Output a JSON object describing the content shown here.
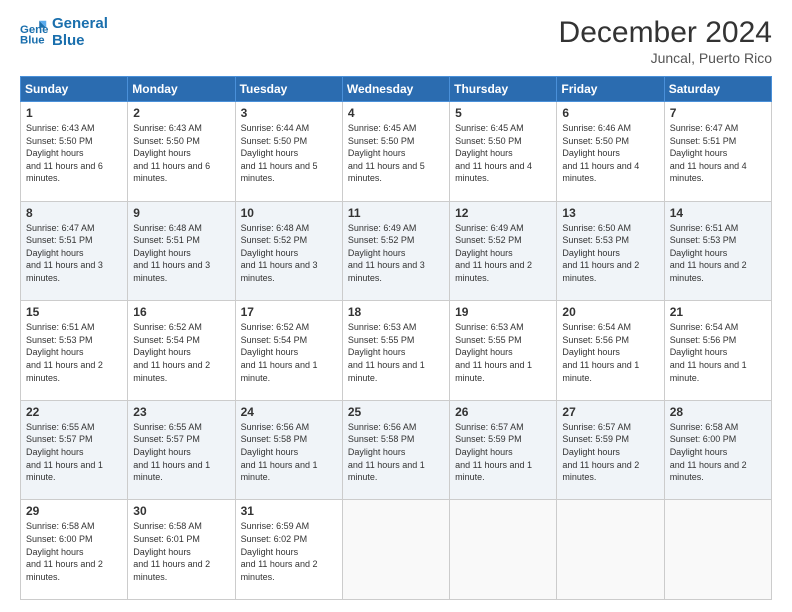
{
  "logo": {
    "line1": "General",
    "line2": "Blue"
  },
  "title": "December 2024",
  "subtitle": "Juncal, Puerto Rico",
  "days_header": [
    "Sunday",
    "Monday",
    "Tuesday",
    "Wednesday",
    "Thursday",
    "Friday",
    "Saturday"
  ],
  "weeks": [
    [
      {
        "day": "1",
        "sunrise": "6:43 AM",
        "sunset": "5:50 PM",
        "daylight": "11 hours and 6 minutes."
      },
      {
        "day": "2",
        "sunrise": "6:43 AM",
        "sunset": "5:50 PM",
        "daylight": "11 hours and 6 minutes."
      },
      {
        "day": "3",
        "sunrise": "6:44 AM",
        "sunset": "5:50 PM",
        "daylight": "11 hours and 5 minutes."
      },
      {
        "day": "4",
        "sunrise": "6:45 AM",
        "sunset": "5:50 PM",
        "daylight": "11 hours and 5 minutes."
      },
      {
        "day": "5",
        "sunrise": "6:45 AM",
        "sunset": "5:50 PM",
        "daylight": "11 hours and 4 minutes."
      },
      {
        "day": "6",
        "sunrise": "6:46 AM",
        "sunset": "5:50 PM",
        "daylight": "11 hours and 4 minutes."
      },
      {
        "day": "7",
        "sunrise": "6:47 AM",
        "sunset": "5:51 PM",
        "daylight": "11 hours and 4 minutes."
      }
    ],
    [
      {
        "day": "8",
        "sunrise": "6:47 AM",
        "sunset": "5:51 PM",
        "daylight": "11 hours and 3 minutes."
      },
      {
        "day": "9",
        "sunrise": "6:48 AM",
        "sunset": "5:51 PM",
        "daylight": "11 hours and 3 minutes."
      },
      {
        "day": "10",
        "sunrise": "6:48 AM",
        "sunset": "5:52 PM",
        "daylight": "11 hours and 3 minutes."
      },
      {
        "day": "11",
        "sunrise": "6:49 AM",
        "sunset": "5:52 PM",
        "daylight": "11 hours and 3 minutes."
      },
      {
        "day": "12",
        "sunrise": "6:49 AM",
        "sunset": "5:52 PM",
        "daylight": "11 hours and 2 minutes."
      },
      {
        "day": "13",
        "sunrise": "6:50 AM",
        "sunset": "5:53 PM",
        "daylight": "11 hours and 2 minutes."
      },
      {
        "day": "14",
        "sunrise": "6:51 AM",
        "sunset": "5:53 PM",
        "daylight": "11 hours and 2 minutes."
      }
    ],
    [
      {
        "day": "15",
        "sunrise": "6:51 AM",
        "sunset": "5:53 PM",
        "daylight": "11 hours and 2 minutes."
      },
      {
        "day": "16",
        "sunrise": "6:52 AM",
        "sunset": "5:54 PM",
        "daylight": "11 hours and 2 minutes."
      },
      {
        "day": "17",
        "sunrise": "6:52 AM",
        "sunset": "5:54 PM",
        "daylight": "11 hours and 1 minute."
      },
      {
        "day": "18",
        "sunrise": "6:53 AM",
        "sunset": "5:55 PM",
        "daylight": "11 hours and 1 minute."
      },
      {
        "day": "19",
        "sunrise": "6:53 AM",
        "sunset": "5:55 PM",
        "daylight": "11 hours and 1 minute."
      },
      {
        "day": "20",
        "sunrise": "6:54 AM",
        "sunset": "5:56 PM",
        "daylight": "11 hours and 1 minute."
      },
      {
        "day": "21",
        "sunrise": "6:54 AM",
        "sunset": "5:56 PM",
        "daylight": "11 hours and 1 minute."
      }
    ],
    [
      {
        "day": "22",
        "sunrise": "6:55 AM",
        "sunset": "5:57 PM",
        "daylight": "11 hours and 1 minute."
      },
      {
        "day": "23",
        "sunrise": "6:55 AM",
        "sunset": "5:57 PM",
        "daylight": "11 hours and 1 minute."
      },
      {
        "day": "24",
        "sunrise": "6:56 AM",
        "sunset": "5:58 PM",
        "daylight": "11 hours and 1 minute."
      },
      {
        "day": "25",
        "sunrise": "6:56 AM",
        "sunset": "5:58 PM",
        "daylight": "11 hours and 1 minute."
      },
      {
        "day": "26",
        "sunrise": "6:57 AM",
        "sunset": "5:59 PM",
        "daylight": "11 hours and 1 minute."
      },
      {
        "day": "27",
        "sunrise": "6:57 AM",
        "sunset": "5:59 PM",
        "daylight": "11 hours and 2 minutes."
      },
      {
        "day": "28",
        "sunrise": "6:58 AM",
        "sunset": "6:00 PM",
        "daylight": "11 hours and 2 minutes."
      }
    ],
    [
      {
        "day": "29",
        "sunrise": "6:58 AM",
        "sunset": "6:00 PM",
        "daylight": "11 hours and 2 minutes."
      },
      {
        "day": "30",
        "sunrise": "6:58 AM",
        "sunset": "6:01 PM",
        "daylight": "11 hours and 2 minutes."
      },
      {
        "day": "31",
        "sunrise": "6:59 AM",
        "sunset": "6:02 PM",
        "daylight": "11 hours and 2 minutes."
      },
      null,
      null,
      null,
      null
    ]
  ]
}
